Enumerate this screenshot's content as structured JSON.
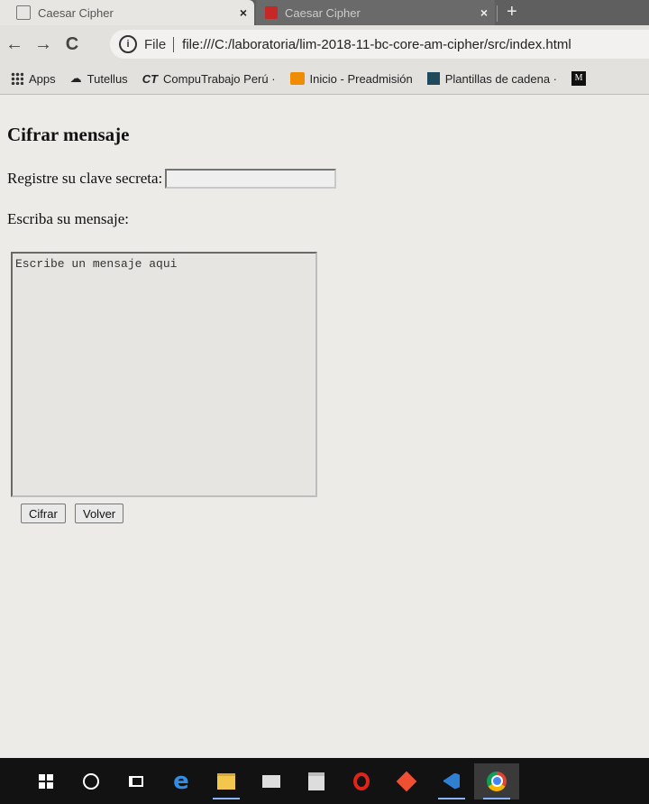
{
  "browser": {
    "tabs": [
      {
        "title": "Caesar Cipher",
        "active": true,
        "close": "×"
      },
      {
        "title": "Caesar Cipher",
        "active": false,
        "close": "×"
      }
    ],
    "new_tab": "+",
    "nav": {
      "back": "←",
      "forward": "→",
      "reload": "C"
    },
    "omnibox": {
      "info": "i",
      "scheme": "File",
      "url": "file:///C:/laboratoria/lim-2018-11-bc-core-am-cipher/src/index.html"
    },
    "bookmarks": [
      {
        "label": "Apps",
        "icon": "apps-grid-icon"
      },
      {
        "label": "Tutellus",
        "icon": "tutellus-icon"
      },
      {
        "label": "CompuTrabajo Perú ·",
        "icon": "computrabajo-icon",
        "icon_text": "CT"
      },
      {
        "label": "Inicio - Preadmisión",
        "icon": "preadmision-icon"
      },
      {
        "label": "Plantillas de cadena ·",
        "icon": "plantillas-icon"
      },
      {
        "label": "",
        "icon": "m-icon",
        "icon_text": "M"
      }
    ]
  },
  "page": {
    "title": "Cifrar mensaje",
    "key_label": "Registre su clave secreta:",
    "key_value": "",
    "message_label": "Escriba su mensaje:",
    "message_placeholder": "Escribe un mensaje aqui",
    "cipher_button": "Cifrar",
    "back_button": "Volver"
  },
  "taskbar": {
    "items": [
      "windows-start-icon",
      "cortana-icon",
      "task-view-icon",
      "edge-icon",
      "file-explorer-icon",
      "mail-icon",
      "store-icon",
      "opera-icon",
      "git-icon",
      "vscode-icon",
      "chrome-icon"
    ],
    "chrome_letter": ""
  }
}
